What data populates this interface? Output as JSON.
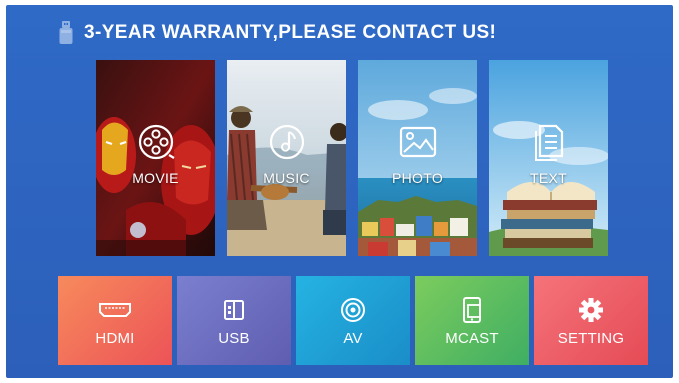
{
  "header": {
    "title": "3-YEAR WARRANTY,PLEASE CONTACT US!",
    "icon": "usb-drive-icon"
  },
  "media_tiles": [
    {
      "label": "MOVIE",
      "icon": "film-reel-icon"
    },
    {
      "label": "MUSIC",
      "icon": "music-note-icon"
    },
    {
      "label": "PHOTO",
      "icon": "photo-icon"
    },
    {
      "label": "TEXT",
      "icon": "document-icon"
    }
  ],
  "source_buttons": [
    {
      "label": "HDMI",
      "icon": "hdmi-port-icon",
      "color": "#f06a59"
    },
    {
      "label": "USB",
      "icon": "usb-icon",
      "color": "#6d6ec0"
    },
    {
      "label": "AV",
      "icon": "av-input-icon",
      "color": "#1e9fd3"
    },
    {
      "label": "MCAST",
      "icon": "screen-mirror-icon",
      "color": "#55bb62"
    },
    {
      "label": "SETTING",
      "icon": "gear-icon",
      "color": "#ee5b63"
    }
  ],
  "colors": {
    "background": "#2f6ac7",
    "title_text": "#ffffff"
  }
}
